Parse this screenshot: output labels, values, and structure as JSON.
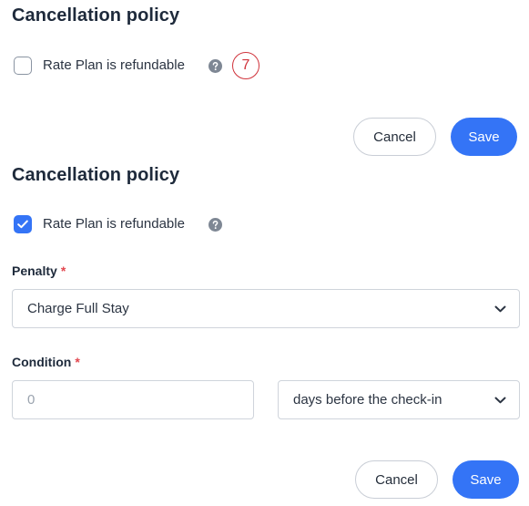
{
  "section1": {
    "title": "Cancellation policy",
    "refundable": {
      "label": "Rate Plan is refundable",
      "checked": false
    },
    "marker_label": "7",
    "cancel_label": "Cancel",
    "save_label": "Save"
  },
  "section2": {
    "title": "Cancellation policy",
    "refundable": {
      "label": "Rate Plan is refundable",
      "checked": true
    },
    "penalty": {
      "label": "Penalty",
      "required_mark": "*",
      "selected": "Charge Full Stay"
    },
    "condition": {
      "label": "Condition",
      "required_mark": "*",
      "days_placeholder": "0",
      "unit_selected": "days before the check-in"
    },
    "cancel_label": "Cancel",
    "save_label": "Save"
  },
  "colors": {
    "accent": "#3474f6",
    "required": "#e2474f",
    "marker": "#d0333b"
  },
  "icons": [
    "question-circle-icon",
    "check-icon",
    "chevron-down-icon"
  ]
}
